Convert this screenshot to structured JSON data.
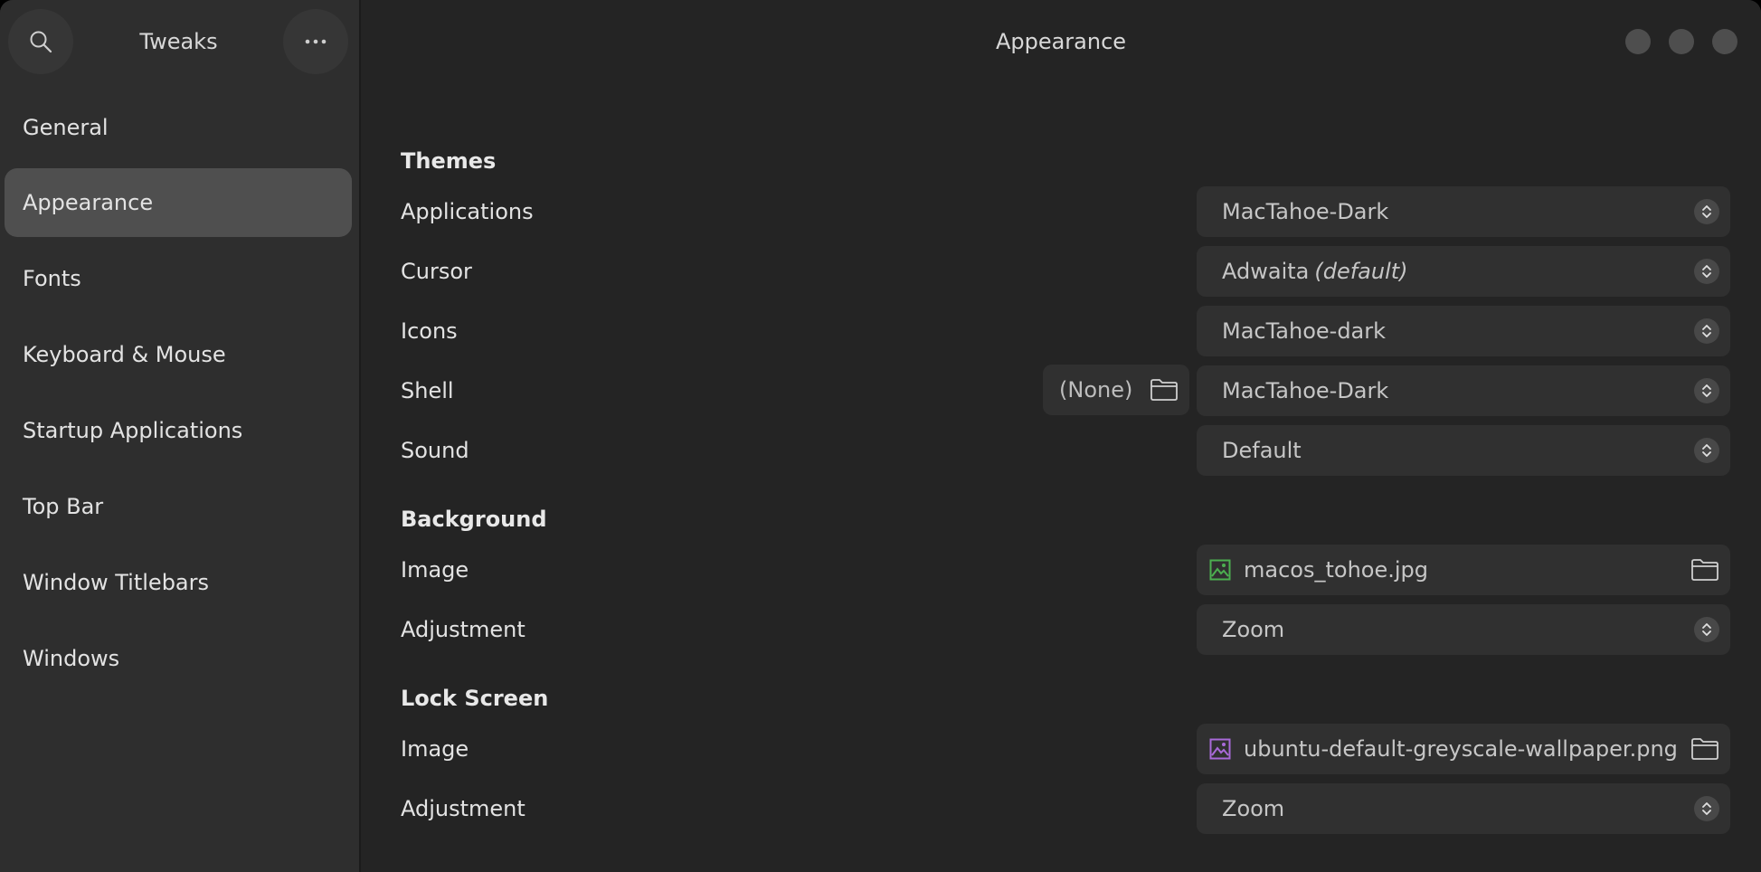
{
  "sidebar": {
    "title": "Tweaks",
    "search_icon": "search-icon",
    "menu_icon": "ellipsis-icon",
    "items": [
      {
        "label": "General"
      },
      {
        "label": "Appearance",
        "active": true
      },
      {
        "label": "Fonts"
      },
      {
        "label": "Keyboard & Mouse"
      },
      {
        "label": "Startup Applications"
      },
      {
        "label": "Top Bar"
      },
      {
        "label": "Window Titlebars"
      },
      {
        "label": "Windows"
      }
    ]
  },
  "main": {
    "title": "Appearance",
    "themes": {
      "heading": "Themes",
      "applications": {
        "label": "Applications",
        "value": "MacTahoe-Dark"
      },
      "cursor": {
        "label": "Cursor",
        "value": "Adwaita",
        "suffix": "(default)"
      },
      "icons": {
        "label": "Icons",
        "value": "MacTahoe-dark"
      },
      "shell": {
        "label": "Shell",
        "file_value": "(None)",
        "value": "MacTahoe-Dark"
      },
      "sound": {
        "label": "Sound",
        "value": "Default"
      }
    },
    "background": {
      "heading": "Background",
      "image": {
        "label": "Image",
        "value": "macos_tohoe.jpg"
      },
      "adjustment": {
        "label": "Adjustment",
        "value": "Zoom"
      }
    },
    "lock_screen": {
      "heading": "Lock Screen",
      "image": {
        "label": "Image",
        "value": "ubuntu-default-greyscale-wallpaper.png"
      },
      "adjustment": {
        "label": "Adjustment",
        "value": "Zoom"
      }
    }
  },
  "colors": {
    "background_image_icon": "#4caf50",
    "lock_image_icon": "#a96ad8",
    "active_nav": "#4f4f4f"
  }
}
